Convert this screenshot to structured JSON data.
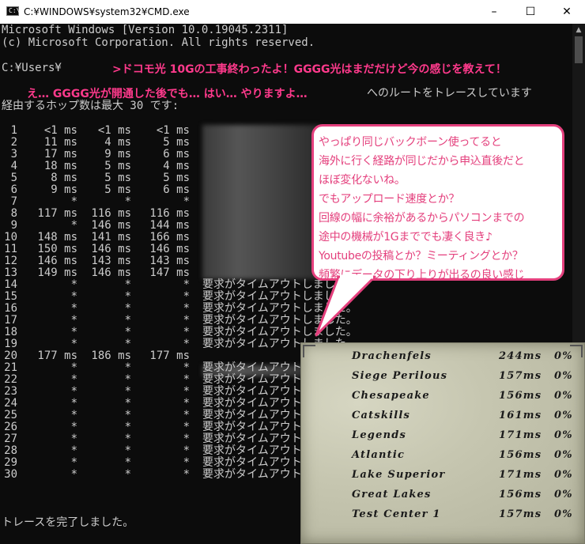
{
  "window": {
    "title": "C:¥WINDOWS¥system32¥CMD.exe",
    "icon": "C:\\",
    "minimize": "–",
    "maximize": "☐",
    "close": "✕"
  },
  "console": {
    "header1": "Microsoft Windows [Version 10.0.19045.2311]",
    "header2": "(c) Microsoft Corporation. All rights reserved.",
    "prompt": "C:¥Users¥",
    "trace_suffix": "へのルートをトレースしています",
    "hops_line": "経由するホップ数は最大 30 です:",
    "complete": "トレースを完了しました。",
    "hops": [
      {
        "n": "1",
        "r1": "<1 ms",
        "r2": "<1 ms",
        "r3": "<1 ms",
        "msg": ""
      },
      {
        "n": "2",
        "r1": "11 ms",
        "r2": "4 ms",
        "r3": "5 ms",
        "msg": ""
      },
      {
        "n": "3",
        "r1": "17 ms",
        "r2": "9 ms",
        "r3": "6 ms",
        "msg": ""
      },
      {
        "n": "4",
        "r1": "18 ms",
        "r2": "5 ms",
        "r3": "4 ms",
        "msg": ""
      },
      {
        "n": "5",
        "r1": "8 ms",
        "r2": "5 ms",
        "r3": "5 ms",
        "msg": ""
      },
      {
        "n": "6",
        "r1": "9 ms",
        "r2": "5 ms",
        "r3": "6 ms",
        "msg": ""
      },
      {
        "n": "7",
        "r1": "*",
        "r2": "*",
        "r3": "*",
        "msg": ""
      },
      {
        "n": "8",
        "r1": "117 ms",
        "r2": "116 ms",
        "r3": "116 ms",
        "msg": ""
      },
      {
        "n": "9",
        "r1": "*",
        "r2": "146 ms",
        "r3": "144 ms",
        "msg": ""
      },
      {
        "n": "10",
        "r1": "148 ms",
        "r2": "141 ms",
        "r3": "166 ms",
        "msg": ""
      },
      {
        "n": "11",
        "r1": "150 ms",
        "r2": "146 ms",
        "r3": "146 ms",
        "msg": ""
      },
      {
        "n": "12",
        "r1": "146 ms",
        "r2": "143 ms",
        "r3": "143 ms",
        "msg": ""
      },
      {
        "n": "13",
        "r1": "149 ms",
        "r2": "146 ms",
        "r3": "147 ms",
        "msg": ""
      },
      {
        "n": "14",
        "r1": "*",
        "r2": "*",
        "r3": "*",
        "msg": "要求がタイムアウトしました。"
      },
      {
        "n": "15",
        "r1": "*",
        "r2": "*",
        "r3": "*",
        "msg": "要求がタイムアウトしました。"
      },
      {
        "n": "16",
        "r1": "*",
        "r2": "*",
        "r3": "*",
        "msg": "要求がタイムアウトしました。"
      },
      {
        "n": "17",
        "r1": "*",
        "r2": "*",
        "r3": "*",
        "msg": "要求がタイムアウトしました。"
      },
      {
        "n": "18",
        "r1": "*",
        "r2": "*",
        "r3": "*",
        "msg": "要求がタイムアウトしました。"
      },
      {
        "n": "19",
        "r1": "*",
        "r2": "*",
        "r3": "*",
        "msg": "要求がタイムアウトしました。"
      },
      {
        "n": "20",
        "r1": "177 ms",
        "r2": "186 ms",
        "r3": "177 ms",
        "msg": ""
      },
      {
        "n": "21",
        "r1": "*",
        "r2": "*",
        "r3": "*",
        "msg": "要求がタイムアウトしました。"
      },
      {
        "n": "22",
        "r1": "*",
        "r2": "*",
        "r3": "*",
        "msg": "要求がタイムアウトしました。"
      },
      {
        "n": "23",
        "r1": "*",
        "r2": "*",
        "r3": "*",
        "msg": "要求がタイムアウトしました。"
      },
      {
        "n": "24",
        "r1": "*",
        "r2": "*",
        "r3": "*",
        "msg": "要求がタイムアウトしました。"
      },
      {
        "n": "25",
        "r1": "*",
        "r2": "*",
        "r3": "*",
        "msg": "要求がタイムアウトしました。"
      },
      {
        "n": "26",
        "r1": "*",
        "r2": "*",
        "r3": "*",
        "msg": "要求がタイムアウトしました。"
      },
      {
        "n": "27",
        "r1": "*",
        "r2": "*",
        "r3": "*",
        "msg": "要求がタイムアウトしました。"
      },
      {
        "n": "28",
        "r1": "*",
        "r2": "*",
        "r3": "*",
        "msg": "要求がタイムアウトしました。"
      },
      {
        "n": "29",
        "r1": "*",
        "r2": "*",
        "r3": "*",
        "msg": "要求がタイムアウトしました。"
      },
      {
        "n": "30",
        "r1": "*",
        "r2": "*",
        "r3": "*",
        "msg": "要求がタイムアウトしました。"
      }
    ]
  },
  "overlay": {
    "question": ">ドコモ光 10Gの工事終わったよ！GGGG光はまだだけど今の感じを教えて！",
    "answer": "え… GGGG光が開通した後でも… はい… やりますよ…",
    "accent": "#ff3a8c"
  },
  "bubble": {
    "color": "#e4407d",
    "lines": [
      "やっぱり同じバックボーン使ってると",
      "海外に行く経路が同じだから申込直後だと",
      "ほぼ変化ないね。",
      "でもアップロード速度とか？",
      "回線の幅に余裕があるからパソコンまでの",
      "途中の機械が1Gまででも凄く良き♪",
      "Youtubeの投稿とか？ミーティングとか？",
      "頻繁にデータの下り上りが出るの良い感じ"
    ]
  },
  "server_panel": {
    "rows": [
      {
        "name": "Drachenfels",
        "ping": "244ms",
        "loss": "0%"
      },
      {
        "name": "Siege Perilous",
        "ping": "157ms",
        "loss": "0%"
      },
      {
        "name": "Chesapeake",
        "ping": "156ms",
        "loss": "0%"
      },
      {
        "name": "Catskills",
        "ping": "161ms",
        "loss": "0%"
      },
      {
        "name": "Legends",
        "ping": "171ms",
        "loss": "0%"
      },
      {
        "name": "Atlantic",
        "ping": "156ms",
        "loss": "0%"
      },
      {
        "name": "Lake Superior",
        "ping": "171ms",
        "loss": "0%"
      },
      {
        "name": "Great Lakes",
        "ping": "156ms",
        "loss": "0%"
      },
      {
        "name": "Test Center 1",
        "ping": "157ms",
        "loss": "0%"
      }
    ]
  }
}
